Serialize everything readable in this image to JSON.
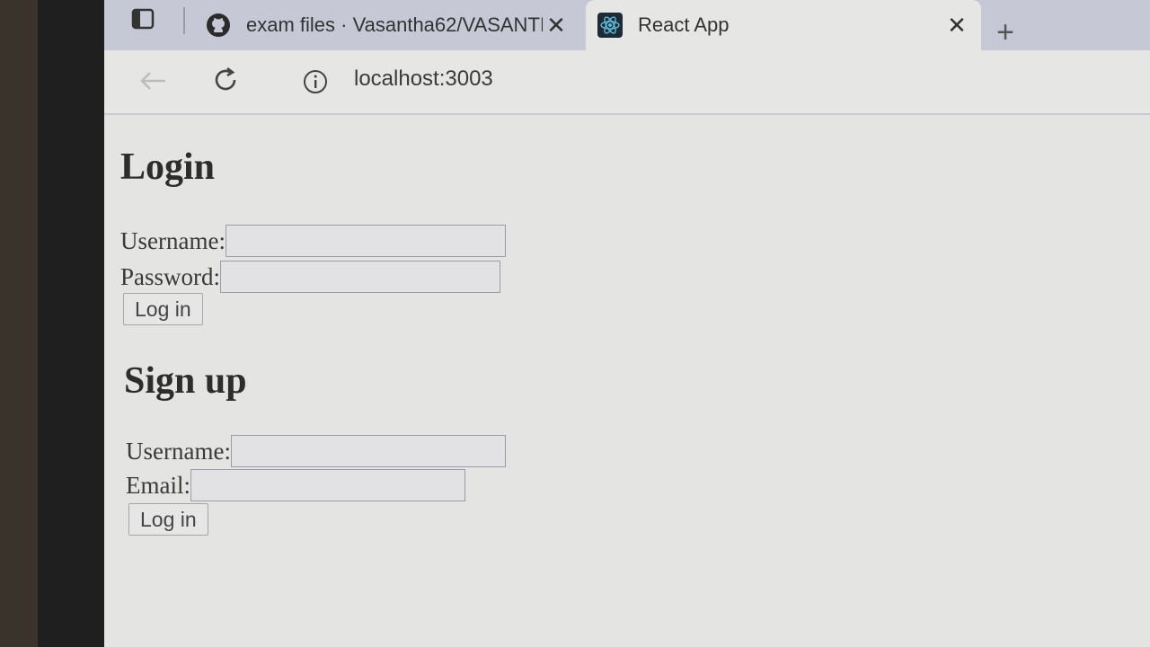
{
  "browser": {
    "tabs": [
      {
        "title": "exam files · Vasantha62/VASANTI",
        "icon": "github-icon",
        "active": false
      },
      {
        "title": "React App",
        "icon": "react-icon",
        "active": true
      }
    ],
    "url": "localhost:3003"
  },
  "login": {
    "heading": "Login",
    "username_label": "Username:",
    "password_label": "Password:",
    "submit_label": "Log in"
  },
  "signup": {
    "heading": "Sign up",
    "username_label": "Username:",
    "email_label": "Email:",
    "submit_label": "Log in"
  }
}
